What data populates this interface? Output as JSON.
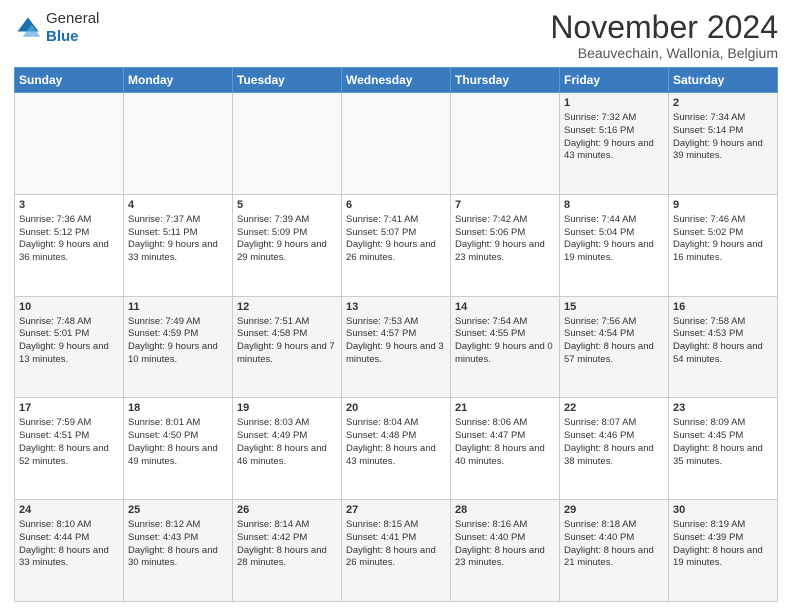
{
  "logo": {
    "line1": "General",
    "line2": "Blue"
  },
  "header": {
    "title": "November 2024",
    "location": "Beauvechain, Wallonia, Belgium"
  },
  "weekdays": [
    "Sunday",
    "Monday",
    "Tuesday",
    "Wednesday",
    "Thursday",
    "Friday",
    "Saturday"
  ],
  "weeks": [
    [
      {
        "day": "",
        "info": ""
      },
      {
        "day": "",
        "info": ""
      },
      {
        "day": "",
        "info": ""
      },
      {
        "day": "",
        "info": ""
      },
      {
        "day": "",
        "info": ""
      },
      {
        "day": "1",
        "info": "Sunrise: 7:32 AM\nSunset: 5:16 PM\nDaylight: 9 hours and 43 minutes."
      },
      {
        "day": "2",
        "info": "Sunrise: 7:34 AM\nSunset: 5:14 PM\nDaylight: 9 hours and 39 minutes."
      }
    ],
    [
      {
        "day": "3",
        "info": "Sunrise: 7:36 AM\nSunset: 5:12 PM\nDaylight: 9 hours and 36 minutes."
      },
      {
        "day": "4",
        "info": "Sunrise: 7:37 AM\nSunset: 5:11 PM\nDaylight: 9 hours and 33 minutes."
      },
      {
        "day": "5",
        "info": "Sunrise: 7:39 AM\nSunset: 5:09 PM\nDaylight: 9 hours and 29 minutes."
      },
      {
        "day": "6",
        "info": "Sunrise: 7:41 AM\nSunset: 5:07 PM\nDaylight: 9 hours and 26 minutes."
      },
      {
        "day": "7",
        "info": "Sunrise: 7:42 AM\nSunset: 5:06 PM\nDaylight: 9 hours and 23 minutes."
      },
      {
        "day": "8",
        "info": "Sunrise: 7:44 AM\nSunset: 5:04 PM\nDaylight: 9 hours and 19 minutes."
      },
      {
        "day": "9",
        "info": "Sunrise: 7:46 AM\nSunset: 5:02 PM\nDaylight: 9 hours and 16 minutes."
      }
    ],
    [
      {
        "day": "10",
        "info": "Sunrise: 7:48 AM\nSunset: 5:01 PM\nDaylight: 9 hours and 13 minutes."
      },
      {
        "day": "11",
        "info": "Sunrise: 7:49 AM\nSunset: 4:59 PM\nDaylight: 9 hours and 10 minutes."
      },
      {
        "day": "12",
        "info": "Sunrise: 7:51 AM\nSunset: 4:58 PM\nDaylight: 9 hours and 7 minutes."
      },
      {
        "day": "13",
        "info": "Sunrise: 7:53 AM\nSunset: 4:57 PM\nDaylight: 9 hours and 3 minutes."
      },
      {
        "day": "14",
        "info": "Sunrise: 7:54 AM\nSunset: 4:55 PM\nDaylight: 9 hours and 0 minutes."
      },
      {
        "day": "15",
        "info": "Sunrise: 7:56 AM\nSunset: 4:54 PM\nDaylight: 8 hours and 57 minutes."
      },
      {
        "day": "16",
        "info": "Sunrise: 7:58 AM\nSunset: 4:53 PM\nDaylight: 8 hours and 54 minutes."
      }
    ],
    [
      {
        "day": "17",
        "info": "Sunrise: 7:59 AM\nSunset: 4:51 PM\nDaylight: 8 hours and 52 minutes."
      },
      {
        "day": "18",
        "info": "Sunrise: 8:01 AM\nSunset: 4:50 PM\nDaylight: 8 hours and 49 minutes."
      },
      {
        "day": "19",
        "info": "Sunrise: 8:03 AM\nSunset: 4:49 PM\nDaylight: 8 hours and 46 minutes."
      },
      {
        "day": "20",
        "info": "Sunrise: 8:04 AM\nSunset: 4:48 PM\nDaylight: 8 hours and 43 minutes."
      },
      {
        "day": "21",
        "info": "Sunrise: 8:06 AM\nSunset: 4:47 PM\nDaylight: 8 hours and 40 minutes."
      },
      {
        "day": "22",
        "info": "Sunrise: 8:07 AM\nSunset: 4:46 PM\nDaylight: 8 hours and 38 minutes."
      },
      {
        "day": "23",
        "info": "Sunrise: 8:09 AM\nSunset: 4:45 PM\nDaylight: 8 hours and 35 minutes."
      }
    ],
    [
      {
        "day": "24",
        "info": "Sunrise: 8:10 AM\nSunset: 4:44 PM\nDaylight: 8 hours and 33 minutes."
      },
      {
        "day": "25",
        "info": "Sunrise: 8:12 AM\nSunset: 4:43 PM\nDaylight: 8 hours and 30 minutes."
      },
      {
        "day": "26",
        "info": "Sunrise: 8:14 AM\nSunset: 4:42 PM\nDaylight: 8 hours and 28 minutes."
      },
      {
        "day": "27",
        "info": "Sunrise: 8:15 AM\nSunset: 4:41 PM\nDaylight: 8 hours and 26 minutes."
      },
      {
        "day": "28",
        "info": "Sunrise: 8:16 AM\nSunset: 4:40 PM\nDaylight: 8 hours and 23 minutes."
      },
      {
        "day": "29",
        "info": "Sunrise: 8:18 AM\nSunset: 4:40 PM\nDaylight: 8 hours and 21 minutes."
      },
      {
        "day": "30",
        "info": "Sunrise: 8:19 AM\nSunset: 4:39 PM\nDaylight: 8 hours and 19 minutes."
      }
    ]
  ]
}
